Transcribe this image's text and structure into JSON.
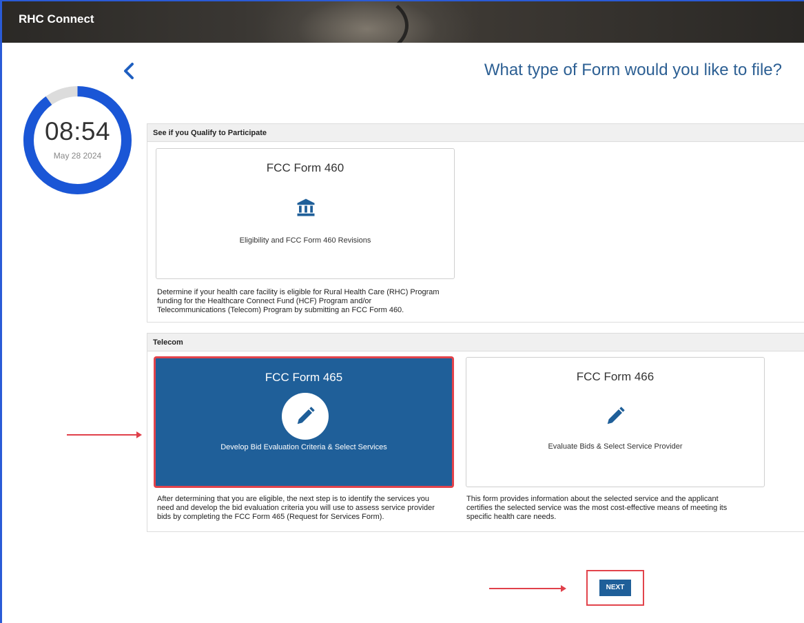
{
  "app": {
    "title": "RHC Connect"
  },
  "timer": {
    "time": "08:54",
    "date": "May 28 2024",
    "elapsed_fraction": 0.9
  },
  "page": {
    "question": "What type of Form would you like to file?"
  },
  "sections": [
    {
      "heading": "See if you Qualify to Participate",
      "cards": [
        {
          "title": "FCC Form 460",
          "subtitle": "Eligibility and FCC Form 460 Revisions",
          "icon": "bank-icon",
          "description": [
            "Determine if your health care facility is eligible for Rural Health Care (RHC) Program",
            "funding for the Healthcare Connect Fund (HCF) Program and/or",
            "Telecommunications (Telecom) Program by submitting an FCC Form 460."
          ]
        }
      ]
    },
    {
      "heading": "Telecom",
      "cards": [
        {
          "title": "FCC Form 465",
          "subtitle": "Develop Bid Evaluation Criteria & Select Services",
          "icon": "pencil-icon",
          "selected": true,
          "description": [
            "After determining that you are eligible, the next step is to identify the services you",
            "need and develop the bid evaluation criteria you will use to assess service provider",
            "bids by completing the FCC Form 465 (Request for Services Form)."
          ]
        },
        {
          "title": "FCC Form 466",
          "subtitle": "Evaluate Bids & Select Service Provider",
          "icon": "pencil-icon",
          "selected": false,
          "description": [
            "This form provides information about the selected service and the applicant",
            "certifies the selected service was the most cost-effective means of meeting its",
            "specific health care needs."
          ]
        }
      ]
    }
  ],
  "actions": {
    "next_label": "NEXT"
  },
  "colors": {
    "accent": "#1f5f99",
    "highlight": "#e2434b",
    "title": "#2c5f93"
  }
}
